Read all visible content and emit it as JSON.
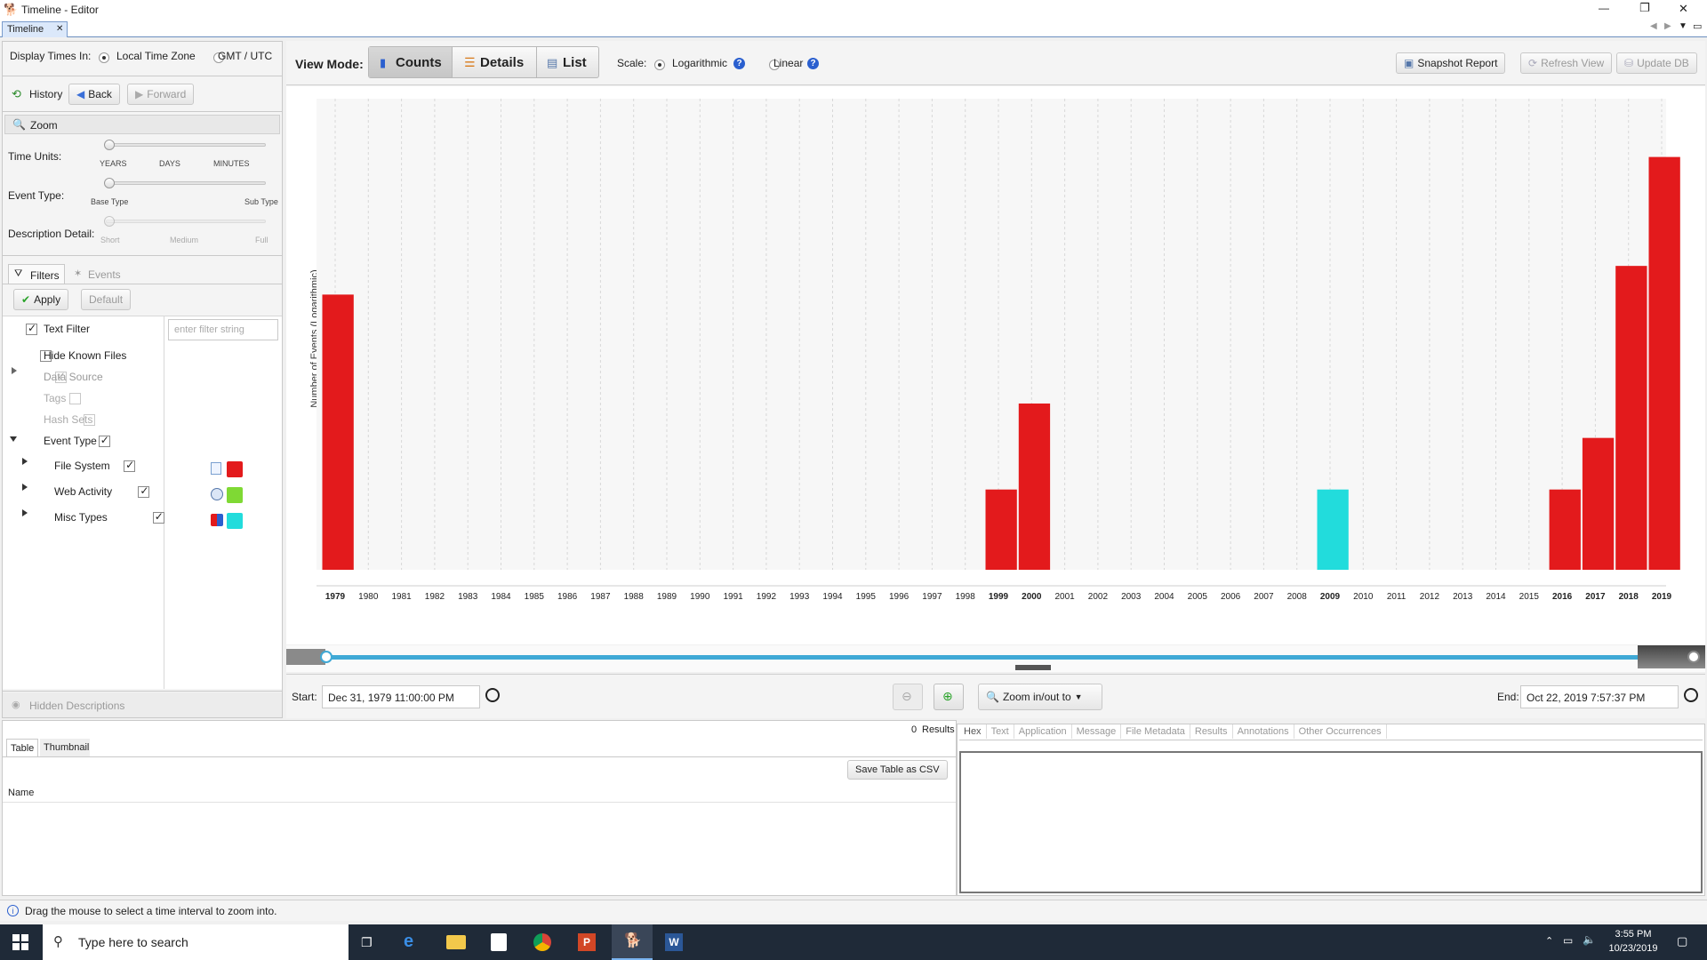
{
  "window": {
    "title": "Timeline - Editor",
    "tab": "Timeline",
    "tab_close": "✕",
    "controls": {
      "min": "—",
      "max": "❐",
      "close": "✕"
    }
  },
  "toolbar_left": {
    "display_times_label": "Display Times In:",
    "local_tz": "Local Time Zone",
    "gmt": "GMT / UTC",
    "history": "History",
    "back": "Back",
    "forward": "Forward"
  },
  "zoom": {
    "title": "Zoom",
    "time_units_label": "Time Units:",
    "time_units_ticks": [
      "YEARS",
      "DAYS",
      "MINUTES"
    ],
    "event_type_label": "Event Type:",
    "event_type_ticks": [
      "Base Type",
      "Sub Type"
    ],
    "desc_detail_label": "Description Detail:",
    "desc_detail_ticks": [
      "Short",
      "Medium",
      "Full"
    ]
  },
  "filters": {
    "tab_filters": "Filters",
    "tab_events": "Events",
    "apply": "Apply",
    "default": "Default",
    "text_filter_placeholder": "enter filter string",
    "items": [
      {
        "label": "Text Filter",
        "checked": true,
        "disabled": false
      },
      {
        "label": "Hide Known Files",
        "checked": false,
        "disabled": false
      },
      {
        "label": "Data Source",
        "checked": true,
        "disabled": true
      },
      {
        "label": "Tags",
        "checked": false,
        "disabled": true
      },
      {
        "label": "Hash Sets",
        "checked": false,
        "disabled": true
      },
      {
        "label": "Event Type",
        "checked": true,
        "disabled": false
      }
    ],
    "event_types": [
      {
        "label": "File System",
        "color": "#e31a1c"
      },
      {
        "label": "Web Activity",
        "color": "#7fd934"
      },
      {
        "label": "Misc Types",
        "color": "#22dcdc"
      }
    ],
    "hidden_descriptions": "Hidden Descriptions"
  },
  "view": {
    "view_mode_label": "View Mode:",
    "counts": "Counts",
    "details": "Details",
    "list": "List",
    "scale_label": "Scale:",
    "logarithmic": "Logarithmic",
    "linear": "Linear",
    "snapshot": "Snapshot Report",
    "refresh": "Refresh View",
    "update_db": "Update DB"
  },
  "chart_data": {
    "type": "bar",
    "ylabel": "Number of Events (Logarithmic)",
    "scale": "logarithmic",
    "categories": [
      "1979",
      "1980",
      "1981",
      "1982",
      "1983",
      "1984",
      "1985",
      "1986",
      "1987",
      "1988",
      "1989",
      "1990",
      "1991",
      "1992",
      "1993",
      "1994",
      "1995",
      "1996",
      "1997",
      "1998",
      "1999",
      "2000",
      "2001",
      "2002",
      "2003",
      "2004",
      "2005",
      "2006",
      "2007",
      "2008",
      "2009",
      "2010",
      "2011",
      "2012",
      "2013",
      "2014",
      "2015",
      "2016",
      "2017",
      "2018",
      "2019"
    ],
    "bold_years": [
      "1979",
      "1999",
      "2000",
      "2009",
      "2016",
      "2017",
      "2018",
      "2019"
    ],
    "bars": [
      {
        "year": "1979",
        "level": 0.48,
        "color": "#e31a1c"
      },
      {
        "year": "1999",
        "level": 0.14,
        "color": "#e31a1c"
      },
      {
        "year": "2000",
        "level": 0.29,
        "color": "#e31a1c"
      },
      {
        "year": "2009",
        "level": 0.14,
        "color": "#22dcdc"
      },
      {
        "year": "2016",
        "level": 0.14,
        "color": "#e31a1c"
      },
      {
        "year": "2017",
        "level": 0.23,
        "color": "#e31a1c"
      },
      {
        "year": "2018",
        "level": 0.53,
        "color": "#e31a1c"
      },
      {
        "year": "2019",
        "level": 0.72,
        "color": "#e31a1c"
      }
    ],
    "grid": true
  },
  "range": {
    "start_label": "Start:",
    "start_value": "Dec 31, 1979 11:00:00 PM",
    "end_label": "End:",
    "end_value": "Oct 22, 2019 7:57:37 PM",
    "zoom_to": "Zoom in/out to"
  },
  "results": {
    "count": "0",
    "count_label": "Results",
    "tab_table": "Table",
    "tab_thumbnail": "Thumbnail",
    "save_csv": "Save Table as CSV",
    "col_name": "Name",
    "content_tabs": [
      "Hex",
      "Text",
      "Application",
      "Message",
      "File Metadata",
      "Results",
      "Annotations",
      "Other Occurrences"
    ]
  },
  "status": {
    "hint": "Drag the mouse to select a time interval to zoom into."
  },
  "taskbar": {
    "search_placeholder": "Type here to search",
    "time": "3:55 PM",
    "date": "10/23/2019"
  }
}
